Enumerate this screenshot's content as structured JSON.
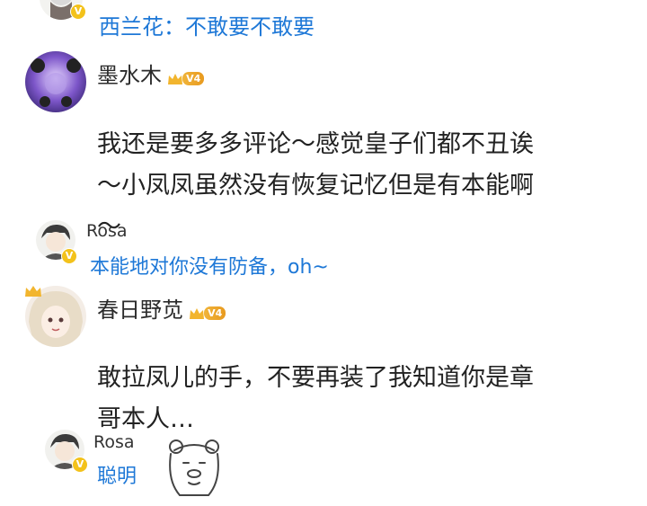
{
  "reply_top": {
    "author_prefix": "西兰花：",
    "text": "不敢要不敢要"
  },
  "comments": [
    {
      "username": "墨水木",
      "level": "V4",
      "body": "我还是要多多评论～感觉皇子们都不丑诶\n～小凤凤虽然没有恢复记忆但是有本能啊\n～",
      "reply": {
        "username": "Rosa",
        "text": "本能地对你没有防备，oh~"
      }
    },
    {
      "username": "春日野苋",
      "level": "V4",
      "body": "敢拉凤儿的手，不要再装了我知道你是章\n哥本人…",
      "reply": {
        "username": "Rosa",
        "text": "聪明"
      }
    }
  ],
  "colors": {
    "link_blue": "#1e78d7",
    "vip_gold": "#f3c21b"
  }
}
